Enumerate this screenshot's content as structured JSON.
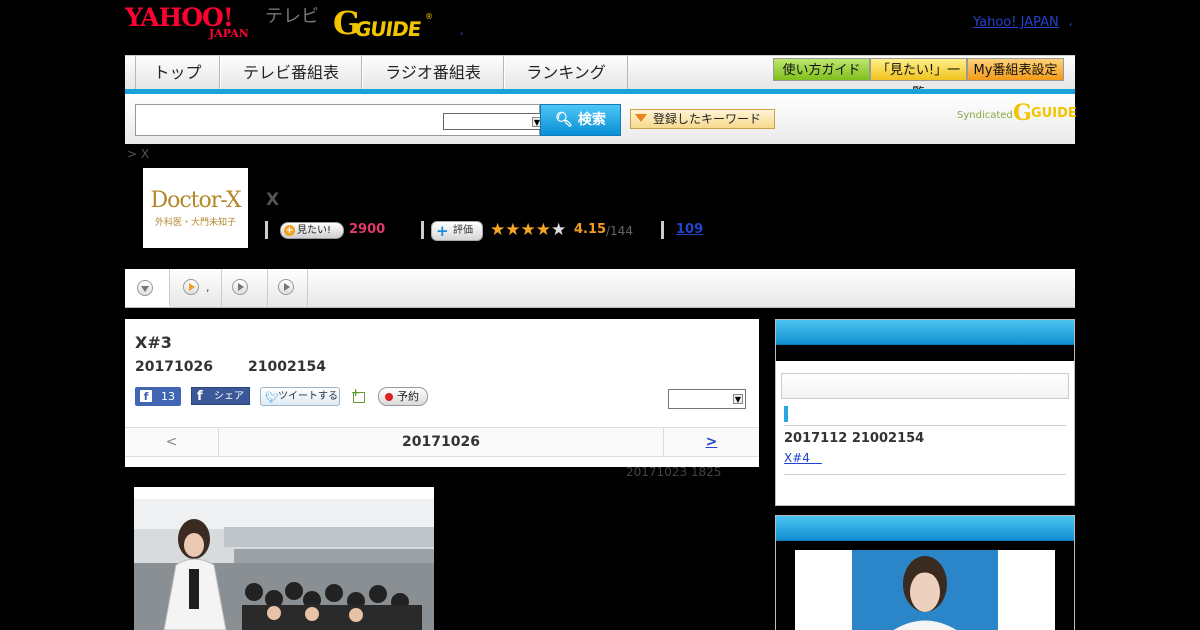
{
  "header": {
    "yahoo_logo_text": "YAHOO!",
    "yahoo_logo_sub": "JAPAN",
    "tv_label": "テレビ",
    "gguide_logo_text": "GUIDE",
    "dot1": ",",
    "yahoo_japan_link": "Yahoo! JAPAN",
    "dot2": ","
  },
  "nav": {
    "tabs": [
      {
        "label": "トップ"
      },
      {
        "label": "テレビ番組表"
      },
      {
        "label": "ラジオ番組表"
      },
      {
        "label": "ランキング"
      }
    ],
    "buttons": [
      {
        "label": "使い方ガイド"
      },
      {
        "label": "「見たい!」一覧"
      },
      {
        "label": "My番組表設定"
      }
    ],
    "accent_color": "#1aa3d9"
  },
  "search": {
    "query": "",
    "select_value": "",
    "button_label": "検索",
    "keyword_button_label": "登録したキーワード",
    "syndicated_label": "Syndicated",
    "syndicated_logo_text": "GUIDE"
  },
  "breadcrumb": "> X",
  "program": {
    "thumb_title": "Doctor-X",
    "thumb_subtitle": "外科医・大門未知子",
    "title": "X",
    "mitai_label": "見たい!",
    "mitai_count": "2900",
    "hyoka_label": "評価",
    "rating": 4.15,
    "rating_display": "4.15",
    "rating_count": "/144",
    "stars_filled": 4,
    "stars_total": 5,
    "review_count": "109"
  },
  "tabstrip": {
    "dot": ","
  },
  "episode": {
    "title": "X#3",
    "date": "20171026",
    "time": "21002154",
    "fb_like_count": "13",
    "fb_share_label": "シェア",
    "tweet_label": "ツイートする",
    "reserve_label": "予約",
    "select_value": "",
    "pager_prev": "<",
    "pager_date": "20171026",
    "pager_next": ">",
    "update_note": "20171023  1825"
  },
  "sidebar": {
    "next_info": "2017112  21002154",
    "next_link": "X#4　"
  }
}
